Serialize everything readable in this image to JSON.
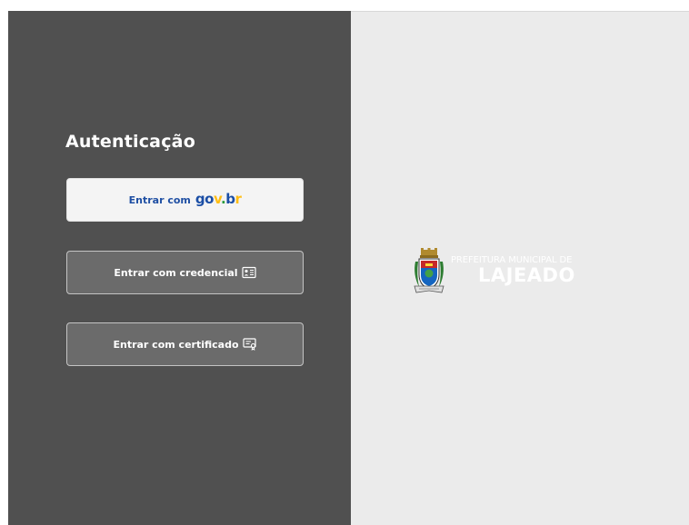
{
  "auth": {
    "title": "Autenticação",
    "govbr_prefix": "Entrar com",
    "govbr_logo": {
      "g": "g",
      "o": "o",
      "v": "v",
      "dot": ".",
      "b": "b",
      "r": "r"
    },
    "credential_label": "Entrar com credencial",
    "certificate_label": "Entrar com certificado"
  },
  "brand": {
    "line1": "PREFEITURA MUNICIPAL DE",
    "line2": "LAJEADO"
  },
  "icons": {
    "credential": "id-card-icon",
    "certificate": "certificate-icon",
    "crest": "coat-of-arms-icon"
  },
  "colors": {
    "left_panel": "#505050",
    "right_panel": "#ebebeb",
    "button_dark": "#6b6b6b",
    "govbr_blue": "#1b4ea5",
    "govbr_yellow": "#ffbe14",
    "govbr_green": "#2a9b3c"
  }
}
